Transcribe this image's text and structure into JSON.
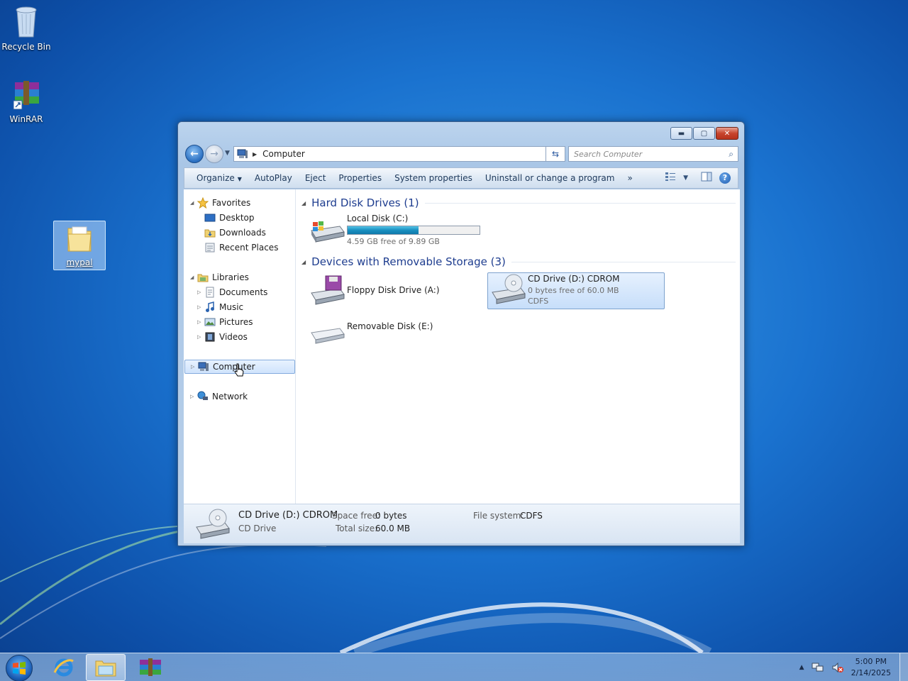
{
  "desktop": {
    "icons": [
      {
        "label": "Recycle Bin"
      },
      {
        "label": "WinRAR"
      },
      {
        "label": "mypal"
      }
    ]
  },
  "window": {
    "address": {
      "path": "Computer"
    },
    "search": {
      "placeholder": "Search Computer"
    },
    "toolbar": {
      "organize": "Organize",
      "autoplay": "AutoPlay",
      "eject": "Eject",
      "properties": "Properties",
      "system_properties": "System properties",
      "uninstall": "Uninstall or change a program",
      "more": "»"
    },
    "nav": {
      "favorites": "Favorites",
      "desktop": "Desktop",
      "downloads": "Downloads",
      "recent_places": "Recent Places",
      "libraries": "Libraries",
      "documents": "Documents",
      "music": "Music",
      "pictures": "Pictures",
      "videos": "Videos",
      "computer": "Computer",
      "network": "Network"
    },
    "groups": {
      "hdd": "Hard Disk Drives (1)",
      "removable": "Devices with Removable Storage (3)"
    },
    "drives": {
      "c": {
        "name": "Local Disk (C:)",
        "free": "4.59 GB free of 9.89 GB",
        "used_fraction": 0.536
      },
      "a": {
        "name": "Floppy Disk Drive (A:)"
      },
      "d": {
        "name": "CD Drive (D:) CDROM",
        "free": "0 bytes free of 60.0 MB",
        "fs": "CDFS"
      },
      "e": {
        "name": "Removable Disk (E:)"
      }
    },
    "details": {
      "name": "CD Drive (D:) CDROM",
      "type": "CD Drive",
      "space_free_label": "Space free:",
      "space_free": "0 bytes",
      "total_size_label": "Total size:",
      "total_size": "60.0 MB",
      "fs_label": "File system:",
      "fs": "CDFS"
    }
  },
  "taskbar": {
    "time": "5:00 PM",
    "date": "2/14/2025"
  },
  "colors": {
    "accent": "#1e3d8f",
    "bar_fill": "#1a8fc0",
    "selection": "#cfe3fc"
  }
}
